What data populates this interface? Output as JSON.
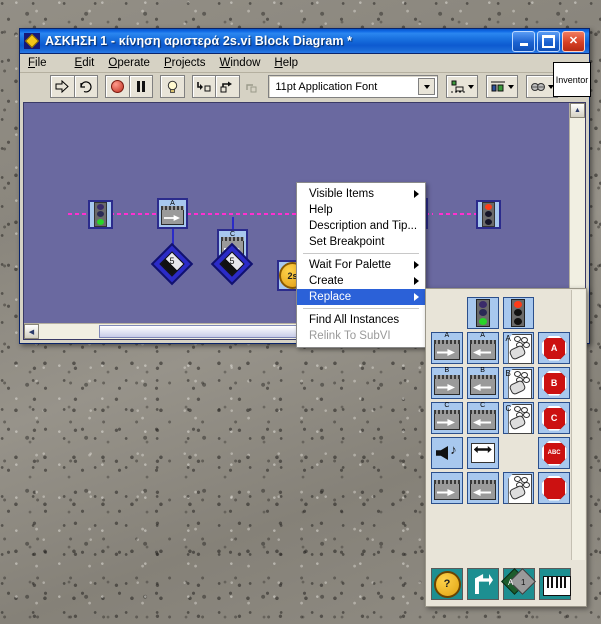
{
  "window": {
    "title": "ΑΣΚΗΣΗ 1 - κίνηση αριστερά 2s.vi Block Diagram *",
    "icon": "labview-diamond-icon",
    "buttons": {
      "minimize": "minimize-button",
      "maximize": "maximize-button",
      "close": "close-button"
    }
  },
  "menubar": {
    "items": [
      {
        "label": "File"
      },
      {
        "label": "Edit"
      },
      {
        "label": "Operate"
      },
      {
        "label": "Projects"
      },
      {
        "label": "Window"
      },
      {
        "label": "Help"
      }
    ]
  },
  "toolbar": {
    "buttons": [
      {
        "name": "run-button",
        "glyph": "⇨"
      },
      {
        "name": "run-continuously-button",
        "glyph": "↻"
      },
      {
        "name": "abort-execution-button",
        "glyph": "●"
      },
      {
        "name": "pause-button",
        "glyph": "❙❙"
      },
      {
        "name": "highlight-execution-button",
        "glyph": "Ὂ1"
      },
      {
        "name": "step-into-button",
        "glyph": "⬇"
      },
      {
        "name": "step-over-button",
        "glyph": "↷"
      },
      {
        "name": "step-out-button",
        "glyph": "⬆"
      }
    ],
    "font_selector": {
      "value": "11pt Application Font"
    },
    "align_objects": "align-objects-dropdown",
    "distribute_objects": "distribute-objects-dropdown",
    "reorder": "reorder-dropdown",
    "help": "context-help-button",
    "inventor_label": "Inventor"
  },
  "diagram": {
    "nodes": [
      {
        "name": "traffic-light-green-terminal",
        "type": "trafficlight",
        "state": "green"
      },
      {
        "name": "motor-node-a",
        "type": "motor",
        "label": "A"
      },
      {
        "name": "motor-node-c",
        "type": "motor",
        "label": "C"
      },
      {
        "name": "wait-timer-node",
        "type": "timer",
        "label": "2s"
      },
      {
        "name": "stop-node",
        "type": "stop"
      },
      {
        "name": "traffic-light-red-terminal",
        "type": "trafficlight",
        "state": "red"
      }
    ],
    "constants": [
      {
        "name": "power-constant-a",
        "value": "5"
      },
      {
        "name": "power-constant-c",
        "value": "5"
      }
    ]
  },
  "context_menu": {
    "items": [
      {
        "label": "Visible Items",
        "submenu": true,
        "selected": false,
        "disabled": false
      },
      {
        "label": "Help",
        "submenu": false,
        "selected": false,
        "disabled": false
      },
      {
        "label": "Description and Tip...",
        "submenu": false,
        "selected": false,
        "disabled": false
      },
      {
        "label": "Set Breakpoint",
        "submenu": false,
        "selected": false,
        "disabled": false
      },
      {
        "separator": true
      },
      {
        "label": "Wait For Palette",
        "submenu": true,
        "selected": false,
        "disabled": false
      },
      {
        "label": "Create",
        "submenu": true,
        "selected": false,
        "disabled": false
      },
      {
        "label": "Replace",
        "submenu": true,
        "selected": true,
        "disabled": false
      },
      {
        "separator": true
      },
      {
        "label": "Find All Instances",
        "submenu": false,
        "selected": false,
        "disabled": false
      },
      {
        "label": "Relink To SubVI",
        "submenu": false,
        "selected": false,
        "disabled": true
      }
    ]
  },
  "palette": {
    "name": "replace-subpalette",
    "rows": [
      [
        {
          "kind": "empty"
        },
        {
          "kind": "trafficlight",
          "state": "green",
          "name": "palette-traffic-light-green"
        },
        {
          "kind": "trafficlight",
          "state": "red",
          "name": "palette-traffic-light-red"
        },
        {
          "kind": "empty"
        }
      ],
      [
        {
          "kind": "motor",
          "label": "A",
          "dir": "right",
          "name": "palette-motor-a-right"
        },
        {
          "kind": "motor",
          "label": "A",
          "dir": "left",
          "name": "palette-motor-a-left"
        },
        {
          "kind": "page",
          "label": "A",
          "name": "palette-page-a"
        },
        {
          "kind": "octagon",
          "label": "A",
          "name": "palette-stop-a"
        }
      ],
      [
        {
          "kind": "motor",
          "label": "B",
          "dir": "right",
          "name": "palette-motor-b-right"
        },
        {
          "kind": "motor",
          "label": "B",
          "dir": "left",
          "name": "palette-motor-b-left"
        },
        {
          "kind": "page",
          "label": "B",
          "name": "palette-page-b"
        },
        {
          "kind": "octagon",
          "label": "B",
          "name": "palette-stop-b"
        }
      ],
      [
        {
          "kind": "motor",
          "label": "C",
          "dir": "right",
          "name": "palette-motor-c-right"
        },
        {
          "kind": "motor",
          "label": "C",
          "dir": "left",
          "name": "palette-motor-c-left"
        },
        {
          "kind": "page",
          "label": "C",
          "name": "palette-page-c"
        },
        {
          "kind": "octagon",
          "label": "C",
          "name": "palette-stop-c"
        }
      ],
      [
        {
          "kind": "sound",
          "name": "palette-play-sound"
        },
        {
          "kind": "leftright",
          "name": "palette-left-right"
        },
        {
          "kind": "empty"
        },
        {
          "kind": "octagon",
          "label": "ABC",
          "name": "palette-stop-abc"
        }
      ],
      [
        {
          "kind": "motor",
          "label": "",
          "dir": "right",
          "name": "palette-motor-right"
        },
        {
          "kind": "motor",
          "label": "",
          "dir": "left",
          "name": "palette-motor-left"
        },
        {
          "kind": "page",
          "label": "",
          "name": "palette-page"
        },
        {
          "kind": "octagon",
          "label": "",
          "name": "palette-stop"
        }
      ]
    ],
    "bottom_row": [
      {
        "kind": "watch",
        "name": "palette-wait-vi"
      },
      {
        "kind": "return",
        "name": "palette-loop-vi"
      },
      {
        "kind": "abdiamond",
        "name": "palette-variable-vi",
        "left": "A",
        "right": "1"
      },
      {
        "kind": "keyboard",
        "name": "palette-keyboard-vi"
      }
    ]
  }
}
